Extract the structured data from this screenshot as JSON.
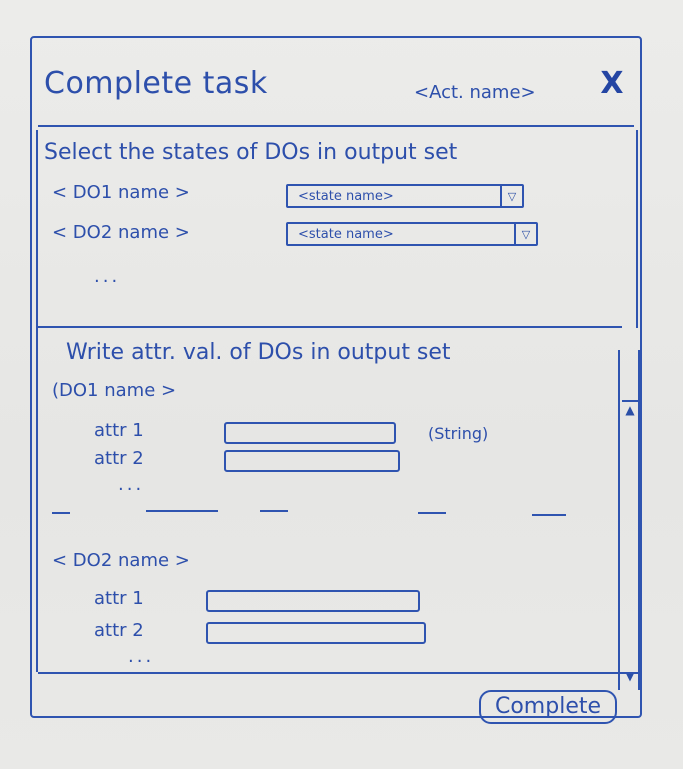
{
  "dialog": {
    "title": "Complete task",
    "activity_name": "<Act. name>",
    "close_glyph": "X"
  },
  "states_section": {
    "heading": "Select the states of DOs in output set",
    "rows": [
      {
        "do_label": "< DO1 name >",
        "state_value": "<state name>"
      },
      {
        "do_label": "< DO2 name >",
        "state_value": "<state name>"
      }
    ],
    "ellipsis": "..."
  },
  "attrs_section": {
    "heading": "Write attr. val. of DOs in output set",
    "groups": [
      {
        "do_label": "(DO1 name >",
        "attrs": [
          {
            "label": "attr 1",
            "value": "",
            "type_hint": "(String)"
          },
          {
            "label": "attr 2",
            "value": ""
          }
        ],
        "ellipsis": "..."
      },
      {
        "do_label": "< DO2 name >",
        "attrs": [
          {
            "label": "attr 1",
            "value": ""
          },
          {
            "label": "attr 2",
            "value": ""
          }
        ],
        "ellipsis": "..."
      }
    ]
  },
  "footer": {
    "complete_label": "Complete"
  },
  "icons": {
    "dropdown": "chevron-down-icon",
    "scroll_up": "arrow-up-icon",
    "scroll_down": "arrow-down-icon",
    "close": "close-icon"
  },
  "colors": {
    "ink": "#2f54b0",
    "board": "#e9e9e7"
  }
}
